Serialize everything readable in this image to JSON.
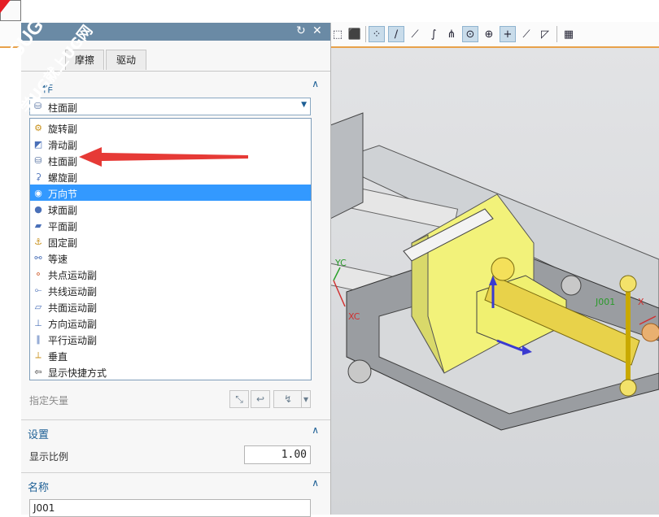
{
  "watermark": {
    "line1": "9SUG",
    "line2": "学UG就上UG网"
  },
  "toolbar": {
    "icons": [
      "cube-face-icon",
      "cube-shaded-icon",
      "snap-points-icon",
      "line-icon",
      "line-dashed-icon",
      "curve-icon",
      "vector-icon",
      "circle-target-icon",
      "circle-cross-icon",
      "plus-icon",
      "diagonal-icon",
      "angle-icon",
      "grid-icon"
    ]
  },
  "panel": {
    "title_icons": [
      "reset-icon",
      "close-icon"
    ],
    "tabs": [
      "摩擦",
      "驱动"
    ],
    "section_action": {
      "title": "作"
    },
    "dropdown": {
      "value": "柱面副"
    },
    "type_options": [
      {
        "label": "旋转副",
        "icon": "revolute-joint-icon"
      },
      {
        "label": "滑动副",
        "icon": "slider-joint-icon"
      },
      {
        "label": "柱面副",
        "icon": "cylindrical-joint-icon"
      },
      {
        "label": "螺旋副",
        "icon": "screw-joint-icon"
      },
      {
        "label": "万向节",
        "icon": "universal-joint-icon"
      },
      {
        "label": "球面副",
        "icon": "spherical-joint-icon"
      },
      {
        "label": "平面副",
        "icon": "planar-joint-icon"
      },
      {
        "label": "固定副",
        "icon": "fixed-joint-icon"
      },
      {
        "label": "等速",
        "icon": "constant-velocity-icon"
      },
      {
        "label": "共点运动副",
        "icon": "point-on-point-icon"
      },
      {
        "label": "共线运动副",
        "icon": "point-on-line-icon"
      },
      {
        "label": "共面运动副",
        "icon": "inplane-joint-icon"
      },
      {
        "label": "方向运动副",
        "icon": "orientation-joint-icon"
      },
      {
        "label": "平行运动副",
        "icon": "parallel-joint-icon"
      },
      {
        "label": "垂直",
        "icon": "perpendicular-icon"
      },
      {
        "label": "显示快捷方式",
        "icon": "show-shortcuts-icon"
      }
    ],
    "selected_option": "万向节",
    "specify_vector": "指定矢量",
    "settings": {
      "title": "设置",
      "scale_label": "显示比例",
      "scale_value": "1.00"
    },
    "name": {
      "title": "名称",
      "value": "J001"
    }
  },
  "viewport": {
    "labels": {
      "yc": "YC",
      "xc": "XC",
      "j001": "J001",
      "x": "X"
    }
  },
  "colors": {
    "accent": "#1d5f95",
    "selection": "#3399ff",
    "title_bar": "#6a8aa5",
    "watermark": "#e51d24",
    "part_yellow": "#f2f27a"
  }
}
